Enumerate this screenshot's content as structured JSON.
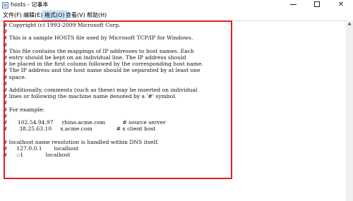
{
  "window": {
    "title": "hosts - 记事本",
    "minimize_glyph": "",
    "maximize_glyph": "",
    "close_glyph": "✕"
  },
  "menu": {
    "file": "文件(F)",
    "edit": "编辑(E)",
    "format": "格式(O)",
    "view": "查看(V)",
    "help": "帮助(H)",
    "highlighted": "format"
  },
  "document": {
    "lines": [
      "# Copyright (c) 1993-2009 Microsoft Corp.",
      "#",
      "# This is a sample HOSTS file used by Microsoft TCP/IP for Windows.",
      "#",
      "# This file contains the mappings of IP addresses to host names. Each",
      "# entry should be kept on an individual line. The IP address should",
      "# be placed in the first column followed by the corresponding host name.",
      "# The IP address and the host name should be separated by at least one",
      "# space.",
      "#",
      "# Additionally, comments (such as these) may be inserted on individual",
      "# lines or following the machine name denoted by a '#' symbol.",
      "#",
      "# For example:",
      "#",
      "#      102.54.94.97     rhino.acme.com          # source server",
      "#       38.25.63.10     x.acme.com              # x client host",
      "",
      "# localhost name resolution is handled within DNS itself.",
      "#\t127.0.0.1       localhost",
      "#\t::1             localhost"
    ]
  },
  "colors": {
    "highlight_box": "#e02020",
    "menu_highlight": "#cce8ff"
  },
  "icons": {
    "app": "notepad-icon",
    "scroll_up": "scroll-up-arrow-icon"
  }
}
